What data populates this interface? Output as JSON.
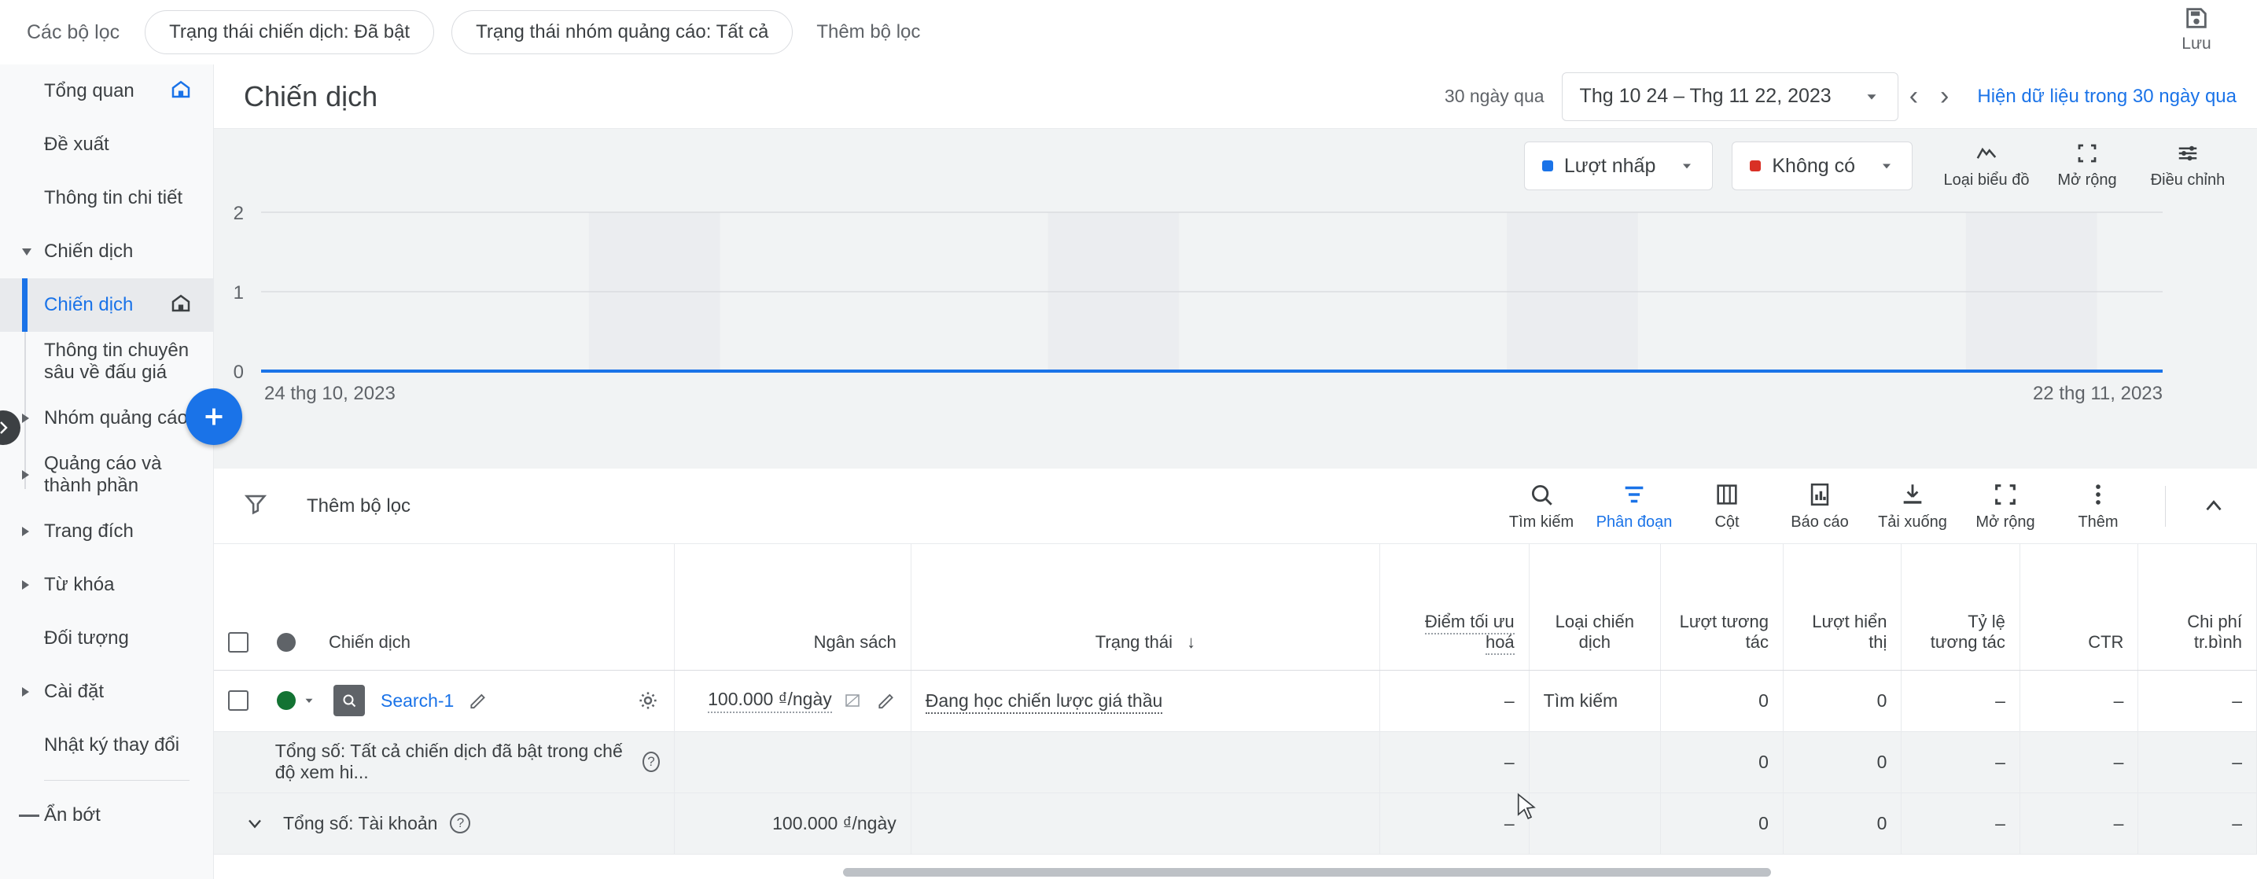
{
  "topbar": {
    "filters_label": "Các bộ lọc",
    "chips": [
      "Trạng thái chiến dịch: Đã bật",
      "Trạng thái nhóm quảng cáo: Tất cả"
    ],
    "add_filter": "Thêm bộ lọc",
    "save_label": "Lưu"
  },
  "sidebar": {
    "items": [
      {
        "label": "Tổng quan",
        "expandable": false,
        "sub": false,
        "home": true,
        "active": false
      },
      {
        "label": "Đề xuất",
        "expandable": false,
        "sub": false,
        "home": false,
        "active": false
      },
      {
        "label": "Thông tin chi tiết",
        "expandable": false,
        "sub": false,
        "home": false,
        "active": false
      },
      {
        "label": "Chiến dịch",
        "expandable": true,
        "expanded": true,
        "sub": false,
        "home": false,
        "active": false
      },
      {
        "label": "Chiến dịch",
        "expandable": false,
        "sub": true,
        "home": true,
        "active": true
      },
      {
        "label": "Thông tin chuyên sâu về đấu giá",
        "expandable": false,
        "sub": true,
        "home": false,
        "active": false
      },
      {
        "label": "Nhóm quảng cáo",
        "expandable": true,
        "expanded": false,
        "sub": false,
        "home": false,
        "active": false
      },
      {
        "label": "Quảng cáo và thành phần",
        "expandable": true,
        "expanded": false,
        "sub": false,
        "home": false,
        "active": false
      },
      {
        "label": "Trang đích",
        "expandable": true,
        "expanded": false,
        "sub": false,
        "home": false,
        "active": false
      },
      {
        "label": "Từ khóa",
        "expandable": true,
        "expanded": false,
        "sub": false,
        "home": false,
        "active": false
      },
      {
        "label": "Đối tượng",
        "expandable": false,
        "sub": false,
        "home": false,
        "active": false
      },
      {
        "label": "Cài đặt",
        "expandable": true,
        "expanded": false,
        "sub": false,
        "home": false,
        "active": false
      },
      {
        "label": "Nhật ký thay đổi",
        "expandable": false,
        "sub": false,
        "home": false,
        "active": false
      }
    ],
    "collapse_label": "Ẩn bớt"
  },
  "header": {
    "title": "Chiến dịch",
    "range_prefix": "30 ngày qua",
    "date_range": "Thg 10 24 – Thg 11 22, 2023",
    "show_data_link": "Hiện dữ liệu trong 30 ngày qua"
  },
  "chart_toolbar": {
    "metric1": {
      "label": "Lượt nhấp",
      "color": "#1a73e8"
    },
    "metric2": {
      "label": "Không có",
      "color": "#d93025"
    },
    "tools": [
      {
        "label": "Loại biểu đồ",
        "icon": "line-chart-icon"
      },
      {
        "label": "Mở rộng",
        "icon": "expand-icon"
      },
      {
        "label": "Điều chỉnh",
        "icon": "adjust-icon"
      }
    ]
  },
  "chart_data": {
    "type": "line",
    "title": "",
    "xlabel": "",
    "ylabel": "",
    "ylim": [
      0,
      2
    ],
    "yticks": [
      0,
      1,
      2
    ],
    "x_start_label": "24 thg 10, 2023",
    "x_end_label": "22 thg 11, 2023",
    "grid": true,
    "legend_position": "top-right",
    "series": [
      {
        "name": "Lượt nhấp",
        "color": "#1a73e8",
        "values": [
          0,
          0,
          0,
          0,
          0,
          0,
          0,
          0,
          0,
          0,
          0,
          0,
          0,
          0,
          0,
          0,
          0,
          0,
          0,
          0,
          0,
          0,
          0,
          0,
          0,
          0,
          0,
          0,
          0,
          0
        ]
      }
    ]
  },
  "table_toolbar": {
    "add_filter": "Thêm bộ lọc",
    "items": [
      {
        "label": "Tìm kiếm",
        "icon": "search-icon",
        "selected": false
      },
      {
        "label": "Phân đoạn",
        "icon": "segment-icon",
        "selected": true
      },
      {
        "label": "Cột",
        "icon": "columns-icon",
        "selected": false
      },
      {
        "label": "Báo cáo",
        "icon": "report-icon",
        "selected": false
      },
      {
        "label": "Tải xuống",
        "icon": "download-icon",
        "selected": false
      },
      {
        "label": "Mở rộng",
        "icon": "expand-icon",
        "selected": false
      },
      {
        "label": "Thêm",
        "icon": "more-vert-icon",
        "selected": false
      }
    ]
  },
  "table": {
    "columns": [
      "Chiến dịch",
      "Ngân sách",
      "Trạng thái",
      "Điểm tối ưu hoá",
      "Loại chiến dịch",
      "Lượt tương tác",
      "Lượt hiển thị",
      "Tỷ lệ tương tác",
      "CTR",
      "Chi phí tr.bình"
    ],
    "sorted_column": "Trạng thái",
    "rows": [
      {
        "campaign": "Search-1",
        "budget": "100.000 ₫/ngày",
        "status": "Đang học chiến lược giá thầu",
        "opt_score": "–",
        "type": "Tìm kiếm",
        "interactions": "0",
        "impressions": "0",
        "interaction_rate": "–",
        "ctr": "–",
        "avg_cost": "–"
      }
    ],
    "totals": [
      {
        "label": "Tổng số: Tất cả chiến dịch đã bật trong chế độ xem hi...",
        "budget": "",
        "status": "",
        "opt_score": "–",
        "type": "",
        "interactions": "0",
        "impressions": "0",
        "interaction_rate": "–",
        "ctr": "–",
        "avg_cost": "–"
      },
      {
        "label": "Tổng số: Tài khoản",
        "budget": "100.000 ₫/ngày",
        "status": "",
        "opt_score": "–",
        "type": "",
        "interactions": "0",
        "impressions": "0",
        "interaction_rate": "–",
        "ctr": "–",
        "avg_cost": "–"
      }
    ]
  }
}
